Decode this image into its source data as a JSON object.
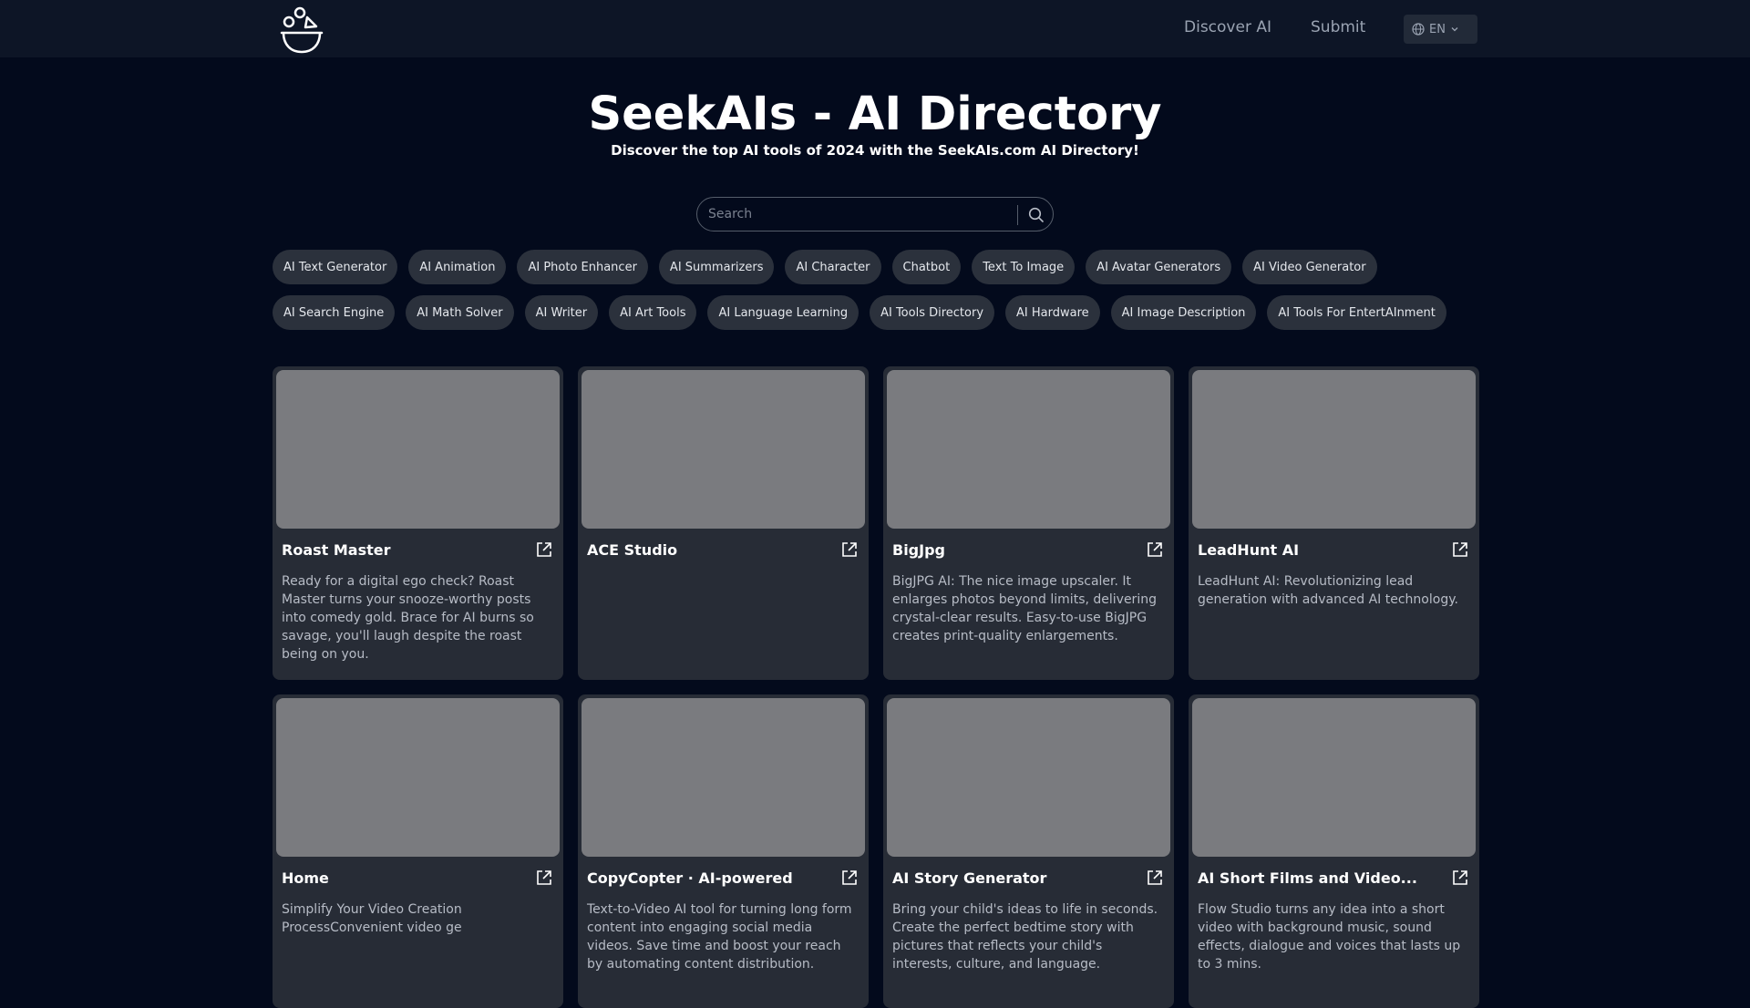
{
  "nav": {
    "discover_label": "Discover AI",
    "submit_label": "Submit",
    "language": "EN"
  },
  "hero": {
    "title": "SeekAIs - AI Directory",
    "subtitle": "Discover the top AI tools of 2024 with the SeekAIs.com AI Directory!"
  },
  "search": {
    "placeholder": "Search",
    "value": ""
  },
  "categories": [
    "AI Text Generator",
    "AI Animation",
    "AI Photo Enhancer",
    "AI Summarizers",
    "AI Character",
    "Chatbot",
    "Text To Image",
    "AI Avatar Generators",
    "AI Video Generator",
    "AI Search Engine",
    "AI Math Solver",
    "AI Writer",
    "AI Art Tools",
    "AI Language Learning",
    "AI Tools Directory",
    "AI Hardware",
    "AI Image Description",
    "AI Tools For EntertAInment"
  ],
  "tools": [
    {
      "title": "Roast Master",
      "description": "Ready for a digital ego check? Roast Master turns your snooze-worthy posts into comedy gold. Brace for AI burns so savage, you'll laugh despite the roast being on you."
    },
    {
      "title": "ACE Studio",
      "description": ""
    },
    {
      "title": "BigJpg",
      "description": "BigJPG AI: The nice image upscaler. It enlarges photos beyond limits, delivering crystal-clear results. Easy-to-use BigJPG creates print-quality enlargements."
    },
    {
      "title": "LeadHunt AI",
      "description": "LeadHunt AI: Revolutionizing lead generation with advanced AI technology."
    },
    {
      "title": "Home",
      "description": "Simplify Your Video Creation ProcessConvenient video ge"
    },
    {
      "title": "CopyCopter · AI-powered",
      "description": "Text-to-Video AI tool for turning long form content into engaging social media videos. Save time and boost your reach by automating content distribution."
    },
    {
      "title": "AI Story Generator",
      "description": "Bring your child's ideas to life in seconds. Create the perfect bedtime story with pictures that reflects your child's interests, culture, and language."
    },
    {
      "title": "AI Short Films and Video...",
      "description": "Flow Studio turns any idea into a short video with background music, sound effects, dialogue and voices that lasts up to 3 mins."
    }
  ],
  "colors": {
    "background": "#030a1c",
    "topbar": "#0d1526",
    "card": "#272c36",
    "tag": "#2b313c",
    "thumbnail": "#7a7b7f"
  }
}
